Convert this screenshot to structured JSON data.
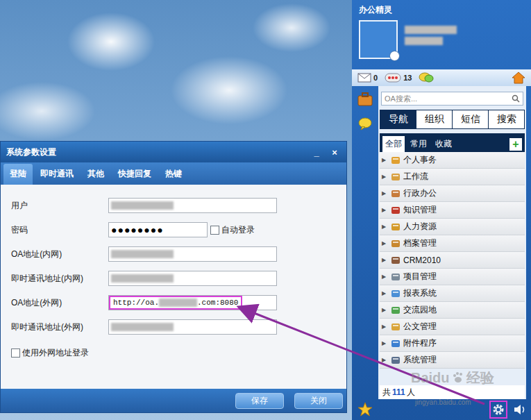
{
  "dialog": {
    "title": "系统参数设置",
    "controls": [
      "_",
      "×"
    ],
    "tabs": [
      {
        "label": "登陆",
        "selected": true
      },
      {
        "label": "即时通讯",
        "selected": false
      },
      {
        "label": "其他",
        "selected": false
      },
      {
        "label": "快捷回复",
        "selected": false
      },
      {
        "label": "热键",
        "selected": false
      }
    ],
    "fields": [
      {
        "label": "用户",
        "kind": "blurred",
        "highlighted": false
      },
      {
        "label": "密码",
        "kind": "password",
        "value": "●●●●●●●●",
        "checkbox": {
          "label": "自动登录",
          "checked": false
        },
        "highlighted": false
      },
      {
        "label": "OA地址(内网)",
        "kind": "blurred",
        "highlighted": false
      },
      {
        "label": "即时通讯地址(内网)",
        "kind": "blurred",
        "highlighted": false
      },
      {
        "label": "OA地址(外网)",
        "kind": "partial",
        "value_start": "http://oa.",
        "value_end": ".com:8080",
        "highlighted": true
      },
      {
        "label": "即时通讯地址(外网)",
        "kind": "blurred",
        "highlighted": false
      }
    ],
    "option": {
      "label": "使用外网地址登录",
      "checked": false
    },
    "buttons": [
      "保存",
      "关闭"
    ]
  },
  "assistant": {
    "title": "办公精灵",
    "counters": [
      "0",
      "13"
    ],
    "search": {
      "placeholder": "OA搜索..."
    },
    "tabs": [
      {
        "label": "导航",
        "selected": true
      },
      {
        "label": "组织",
        "selected": false
      },
      {
        "label": "短信",
        "selected": false
      },
      {
        "label": "搜索",
        "selected": false
      }
    ],
    "subtabs": [
      {
        "label": "全部",
        "selected": true
      },
      {
        "label": "常用",
        "selected": false
      },
      {
        "label": "收藏",
        "selected": false
      }
    ],
    "add_button": "+",
    "tree": {
      "expander": "▶",
      "items": [
        {
          "label": "个人事务",
          "expanded": false
        },
        {
          "label": "工作流",
          "expanded": false
        },
        {
          "label": "行政办公",
          "expanded": false
        },
        {
          "label": "知识管理",
          "expanded": false
        },
        {
          "label": "人力资源",
          "expanded": false
        },
        {
          "label": "档案管理",
          "expanded": false
        },
        {
          "label": "CRM2010",
          "expanded": false
        },
        {
          "label": "项目管理",
          "expanded": false
        },
        {
          "label": "报表系统",
          "expanded": false
        },
        {
          "label": "交流园地",
          "expanded": false
        },
        {
          "label": "公文管理",
          "expanded": false
        },
        {
          "label": "附件程序",
          "expanded": false
        },
        {
          "label": "系统管理",
          "expanded": false
        }
      ]
    },
    "footer": {
      "prefix": "共",
      "count": "111",
      "suffix": "人"
    },
    "settings_highlighted": true
  },
  "watermark": {
    "brand": "Baidu",
    "label": "经验",
    "url": "jingyan.baidu.com"
  }
}
